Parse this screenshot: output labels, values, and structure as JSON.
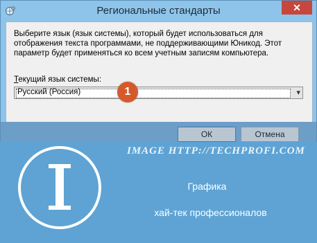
{
  "window": {
    "title": "Региональные стандарты",
    "close_label": "✕",
    "icon": "globe-settings-icon"
  },
  "dialog": {
    "description": "Выберите язык (язык системы), который будет использоваться для отображения текста программами, не поддерживающими Юникод. Этот параметр будет применяться ко всем учетным записям компьютера.",
    "label_accel": "Т",
    "label_rest": "екущий язык системы:",
    "selected_value": "Русский (Россия)",
    "dropdown_arrow": "▾",
    "badge": "1"
  },
  "buttons": {
    "ok_label": "ОК",
    "cancel_label": "Отмена"
  },
  "watermark": {
    "url_text": "IMAGE HTTP://TECHPROFI.COM",
    "line1": "Графика",
    "line2": "хай-тек профессионалов"
  },
  "colors": {
    "title_bar": "#8fc4ea",
    "close_button": "#c7463d",
    "badge": "#d45a2c",
    "watermark_bg": "#5ea3d4"
  }
}
